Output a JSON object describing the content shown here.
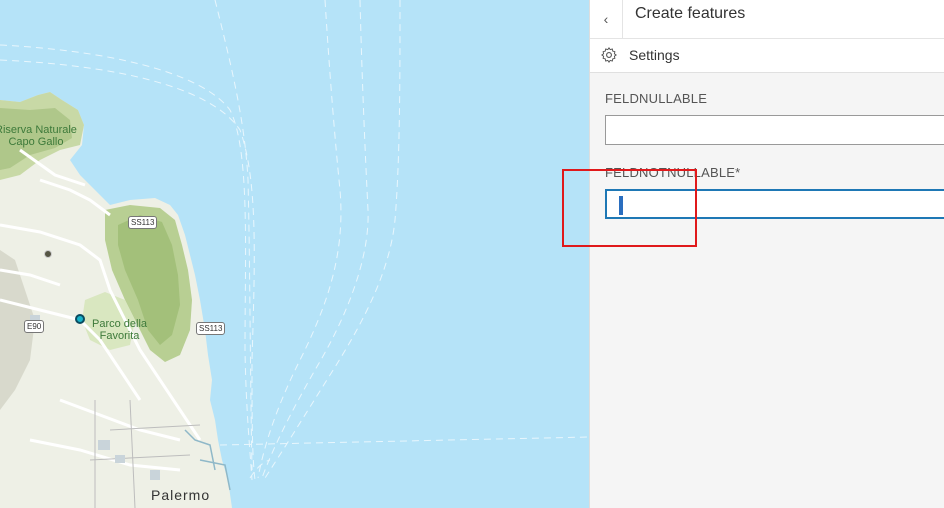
{
  "map": {
    "labels": {
      "reserve": "Riserva Naturale\nCapo Gallo",
      "park": "Parco della\nFavorita",
      "city": "Palermo"
    },
    "roads": {
      "ss113_a": "SS113",
      "ss113_b": "SS113",
      "e90": "E90"
    }
  },
  "panel": {
    "title": "Create features",
    "back_icon": "chevron-left-icon",
    "settings_label": "Settings",
    "settings_icon": "gear-icon",
    "fields": [
      {
        "label": "FELDNULLABLE",
        "value": ""
      },
      {
        "label": "FELDNOTNULLABLE*",
        "value": ""
      }
    ]
  },
  "colors": {
    "water": "#b5e3f8",
    "land": "#eef0e6",
    "focus": "#1e78b5",
    "highlight": "#e0191b"
  }
}
